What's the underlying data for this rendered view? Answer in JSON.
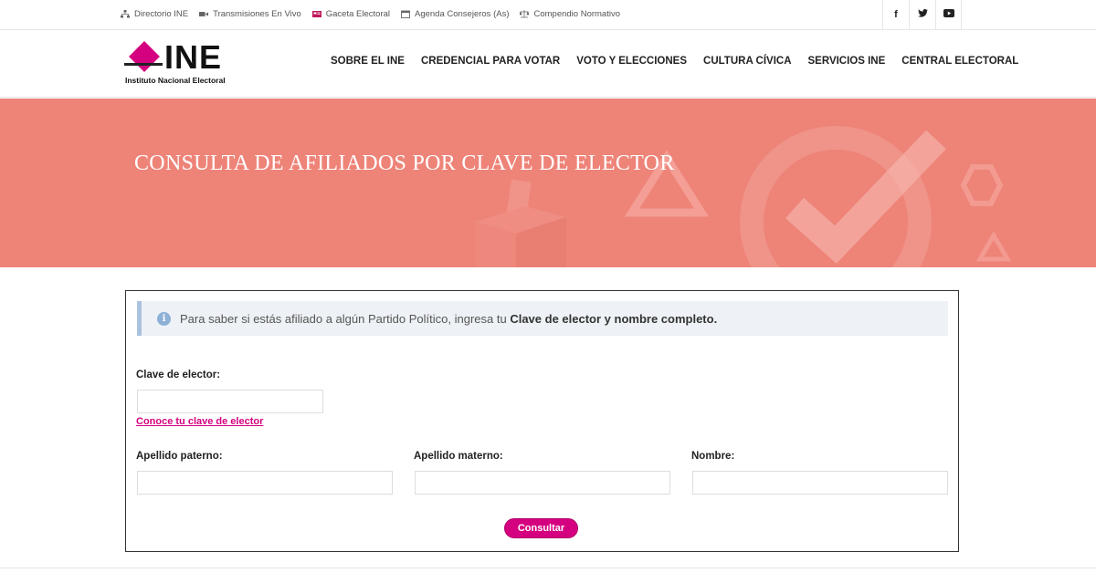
{
  "topbar": {
    "links": [
      {
        "label": "Directorio INE",
        "icon": "sitemap-icon"
      },
      {
        "label": "Transmisiones En Vivo",
        "icon": "video-camera-icon"
      },
      {
        "label": "Gaceta Electoral",
        "icon": "newspaper-icon"
      },
      {
        "label": "Agenda Consejeros (As)",
        "icon": "calendar-icon"
      },
      {
        "label": "Compendio Normativo",
        "icon": "balance-scale-icon"
      }
    ],
    "social": {
      "facebook": "f",
      "twitter": "🐦",
      "youtube": "▶"
    }
  },
  "header": {
    "logo_text": "INE",
    "logo_subtitle": "Instituto Nacional Electoral",
    "nav": [
      "SOBRE EL INE",
      "CREDENCIAL PARA VOTAR",
      "VOTO Y ELECCIONES",
      "CULTURA CÍVICA",
      "SERVICIOS INE",
      "CENTRAL ELECTORAL"
    ]
  },
  "hero": {
    "title": "CONSULTA DE AFILIADOS POR CLAVE DE ELECTOR"
  },
  "form": {
    "notice_prefix": "Para saber si estás afiliado a algún Partido Político, ingresa tu ",
    "notice_bold": "Clave de elector y nombre completo.",
    "clave_label": "Clave de elector:",
    "clave_value": "",
    "clave_link": "Conoce tu clave de elector",
    "paterno_label": "Apellido paterno:",
    "paterno_value": "",
    "materno_label": "Apellido materno:",
    "materno_value": "",
    "nombre_label": "Nombre:",
    "nombre_value": "",
    "submit": "Consultar"
  },
  "colors": {
    "brand_magenta": "#d5007f",
    "hero_bg": "#ee8378",
    "notice_bg": "#eef2f6"
  }
}
